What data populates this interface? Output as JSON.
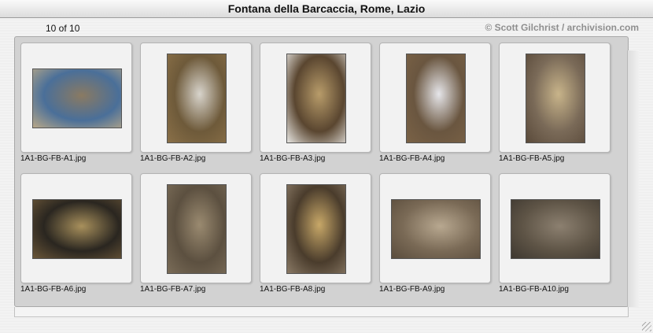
{
  "window": {
    "title": "Fontana della Barcaccia, Rome, Lazio"
  },
  "header": {
    "counter": "10 of 10",
    "credit": "© Scott Gilchrist / archivision.com"
  },
  "photos": [
    {
      "filename": "1A1-BG-FB-A1.jpg",
      "colors": [
        "#4a6f99",
        "#8a7a62",
        "#b8a888"
      ]
    },
    {
      "filename": "1A1-BG-FB-A2.jpg",
      "colors": [
        "#6e5a3a",
        "#d8d4cc",
        "#8a7048"
      ]
    },
    {
      "filename": "1A1-BG-FB-A3.jpg",
      "colors": [
        "#5a4630",
        "#b89c6a",
        "#e8e6e2"
      ]
    },
    {
      "filename": "1A1-BG-FB-A4.jpg",
      "colors": [
        "#6a5640",
        "#e6e6ea",
        "#7a6246"
      ]
    },
    {
      "filename": "1A1-BG-FB-A5.jpg",
      "colors": [
        "#7a6a58",
        "#c8b48a",
        "#5a4a3a"
      ]
    },
    {
      "filename": "1A1-BG-FB-A6.jpg",
      "colors": [
        "#2a2620",
        "#a8905c",
        "#6a5638"
      ]
    },
    {
      "filename": "1A1-BG-FB-A7.jpg",
      "colors": [
        "#5c5040",
        "#9a8a70",
        "#7a6c58"
      ]
    },
    {
      "filename": "1A1-BG-FB-A8.jpg",
      "colors": [
        "#4a3c2c",
        "#c8a868",
        "#8a7a66"
      ]
    },
    {
      "filename": "1A1-BG-FB-A9.jpg",
      "colors": [
        "#7a6a56",
        "#b8a890",
        "#5a4c3c"
      ]
    },
    {
      "filename": "1A1-BG-FB-A10.jpg",
      "colors": [
        "#5e5446",
        "#8c8070",
        "#3e3830"
      ]
    }
  ]
}
